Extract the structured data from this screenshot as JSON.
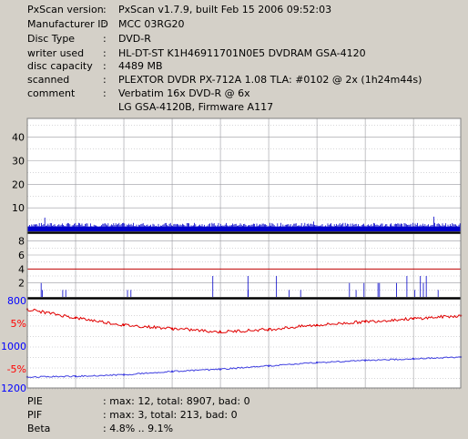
{
  "info": [
    {
      "key": "PxScan version",
      "value": "PxScan v1.7.9, built Feb 15 2006 09:52:03"
    },
    {
      "key": "Manufacturer ID",
      "value": "MCC 03RG20"
    },
    {
      "key": "Disc Type",
      "value": "DVD-R"
    },
    {
      "key": "writer used",
      "value": "HL-DT-ST K1H46911701N0E5 DVDRAM GSA-4120"
    },
    {
      "key": "disc capacity",
      "value": "4489 MB"
    },
    {
      "key": "scanned",
      "value": "PLEXTOR DVDR PX-712A 1.08 TLA: #0102 @ 2x (1h24m44s)"
    },
    {
      "key": "comment",
      "value": "Verbatim 16x DVD-R @ 6x"
    },
    {
      "key": "",
      "value": "LG GSA-4120B, Firmware A117"
    }
  ],
  "colors": {
    "panel": "#d4d0c8",
    "plot_bg": "#ffffff",
    "grid": "#9a9aa0",
    "pie": "#0000c8",
    "pif_threshold": "#c00000",
    "beta_red": "#e00000",
    "beta_blue": "#4040e0",
    "beta_label_red": "#ff0000",
    "beta_label_blue": "#0000ff"
  },
  "chart_data": [
    {
      "type": "area",
      "name_label": "PIE",
      "yticks": [
        "40",
        "30",
        "20",
        "10"
      ],
      "ylim": [
        0,
        48
      ],
      "x": [
        0,
        4489
      ],
      "typical": 2,
      "max": 12,
      "grid": true
    },
    {
      "type": "area",
      "name_label": "PIF",
      "yticks": [
        "8",
        "6",
        "4",
        "2"
      ],
      "ylim": [
        0,
        9
      ],
      "threshold": 4,
      "typical": 0,
      "max": 3,
      "grid": true
    },
    {
      "type": "line",
      "name_label": "Beta",
      "yticks": [
        {
          "label": "800",
          "color": "blue"
        },
        {
          "label": "5%",
          "color": "red"
        },
        {
          "label": "1000",
          "color": "blue"
        },
        {
          "label": "-5%",
          "color": "red"
        },
        {
          "label": "1200",
          "color": "blue"
        }
      ],
      "series": [
        {
          "color": "red",
          "unit": "%",
          "x": [
            0,
            500,
            1000,
            1500,
            2000,
            2500,
            3000,
            3500,
            4000,
            4489
          ],
          "values": [
            8.5,
            6.5,
            4.8,
            4.0,
            3.2,
            3.8,
            4.8,
            5.6,
            6.3,
            7.0
          ]
        },
        {
          "color": "blue",
          "unit": "",
          "x": [
            0,
            500,
            1000,
            1500,
            2000,
            2500,
            3000,
            3500,
            4000,
            4489
          ],
          "values": [
            1150,
            1147,
            1140,
            1125,
            1115,
            1100,
            1085,
            1075,
            1068,
            1060
          ]
        }
      ],
      "grid": true
    }
  ],
  "summary": [
    {
      "key": "PIE",
      "value": ": max: 12, total: 8907, bad: 0"
    },
    {
      "key": "PIF",
      "value": ": max: 3, total: 213, bad: 0"
    },
    {
      "key": "Beta",
      "value": ": 4.8% .. 9.1%"
    }
  ]
}
